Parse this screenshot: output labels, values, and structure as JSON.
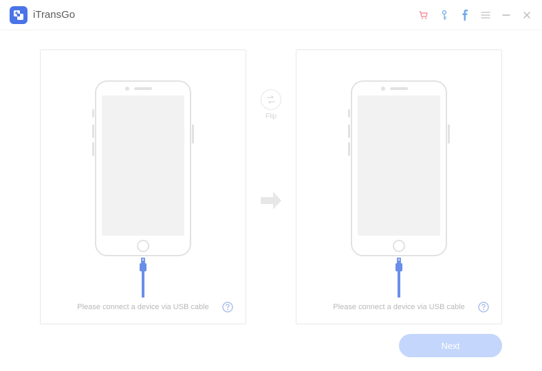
{
  "app": {
    "name": "iTransGo"
  },
  "titlebar": {
    "cart_icon": "cart-icon",
    "facebook_icon": "facebook-icon"
  },
  "flip": {
    "label": "Flip"
  },
  "source": {
    "status": "Please connect a device via USB cable"
  },
  "target": {
    "status": "Please connect a device via USB cable"
  },
  "next": {
    "label": "Next"
  },
  "colors": {
    "accent": "#4a74e8",
    "cart": "#f27f8f",
    "fb": "#6fa9e6",
    "next_bg": "#c4d6fb"
  }
}
